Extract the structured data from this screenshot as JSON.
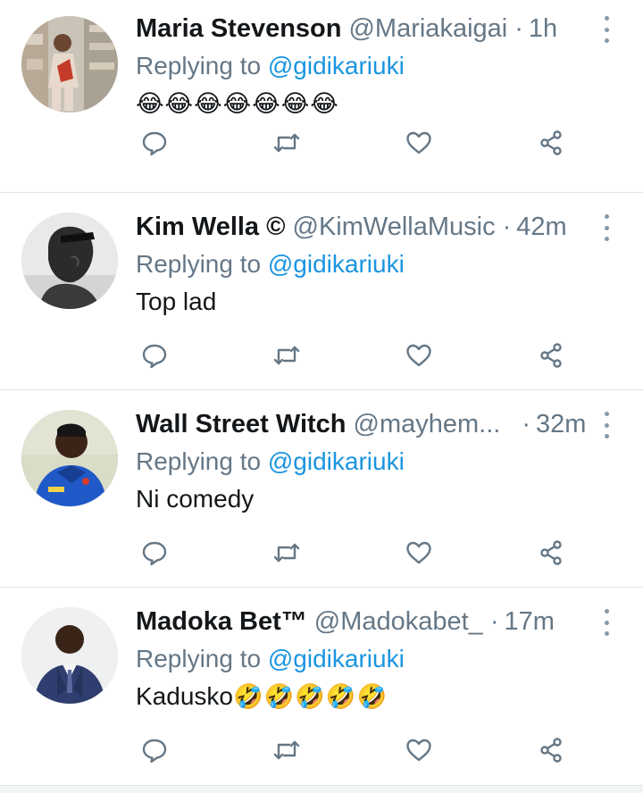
{
  "colors": {
    "link": "#1b95e0",
    "secondary_text": "#657786",
    "icon": "#657786",
    "divider": "#dfe3e6"
  },
  "tweets": [
    {
      "name": "Maria Stevenson",
      "handle": "@Mariakaigai",
      "time": "1h",
      "reply_prefix": "Replying to",
      "reply_to": "@gidikariuki",
      "text": "",
      "emojis": "😂😂😂😂😂😂😂",
      "avatar": "photo-woman-in-store"
    },
    {
      "name": "Kim Wella ©",
      "handle": "@KimWellaMusic",
      "time": "42m",
      "reply_prefix": "Replying to",
      "reply_to": "@gidikariuki",
      "text": "Top lad",
      "emojis": "",
      "avatar": "photo-man-bw-sunglasses"
    },
    {
      "name": "Wall Street Witch",
      "handle": "@mayhem...",
      "time": "32m",
      "reply_prefix": "Replying to",
      "reply_to": "@gidikariuki",
      "text": "Ni comedy",
      "emojis": "",
      "avatar": "photo-man-blue-jersey"
    },
    {
      "name": "Madoka Bet™",
      "handle": "@Madokabet_",
      "time": "17m",
      "reply_prefix": "Replying to",
      "reply_to": "@gidikariuki",
      "text": "Kadusko",
      "emojis": "🤣🤣🤣🤣🤣",
      "avatar": "photo-man-suit"
    }
  ],
  "icons": {
    "reply": "reply-icon",
    "retweet": "retweet-icon",
    "like": "heart-icon",
    "share": "share-icon",
    "more": "more-vertical-icon"
  }
}
